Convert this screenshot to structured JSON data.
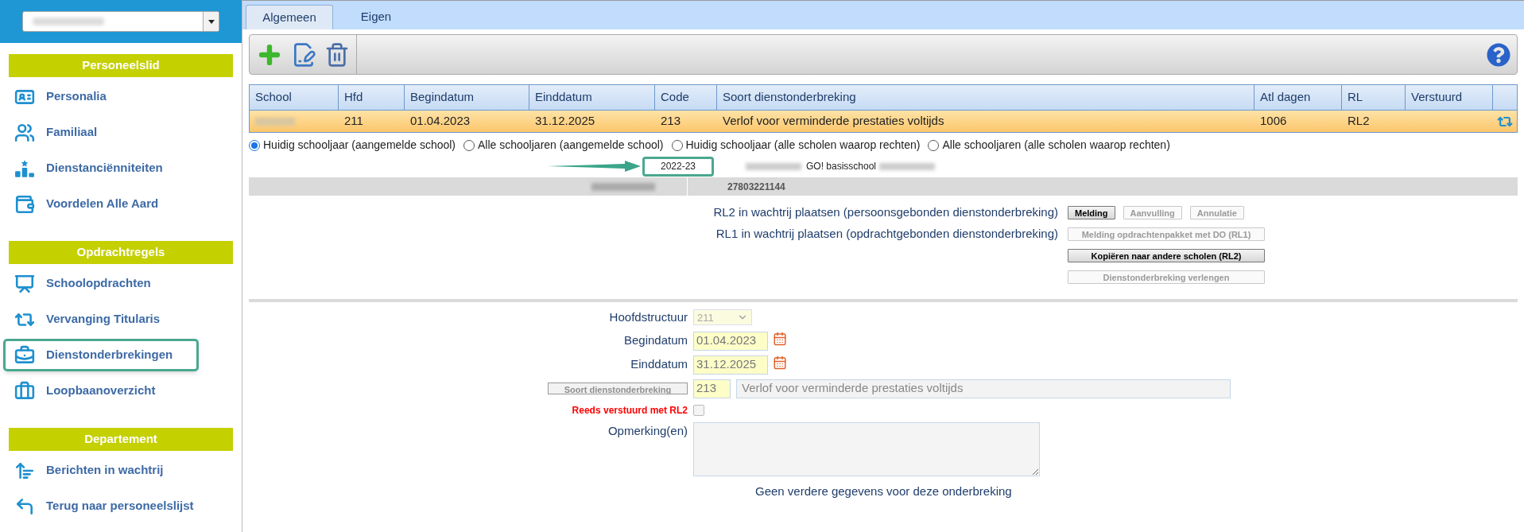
{
  "sidebar": {
    "sections": [
      {
        "title": "Personeelslid",
        "items": [
          {
            "label": "Personalia",
            "selected": false
          },
          {
            "label": "Familiaal",
            "selected": false
          },
          {
            "label": "Dienstanciënniteiten",
            "selected": false
          },
          {
            "label": "Voordelen Alle Aard",
            "selected": false
          }
        ]
      },
      {
        "title": "Opdrachtregels",
        "items": [
          {
            "label": "Schoolopdrachten",
            "selected": false
          },
          {
            "label": "Vervanging Titularis",
            "selected": false
          },
          {
            "label": "Dienstonderbrekingen",
            "selected": true
          },
          {
            "label": "Loopbaanoverzicht",
            "selected": false
          }
        ]
      },
      {
        "title": "Departement",
        "items": [
          {
            "label": "Berichten in wachtrij",
            "selected": false
          },
          {
            "label": "Terug naar personeelslijst",
            "selected": false
          }
        ]
      }
    ]
  },
  "tabs": [
    {
      "label": "Algemeen",
      "selected": true
    },
    {
      "label": "Eigen",
      "selected": false
    }
  ],
  "table": {
    "columns": [
      "School",
      "Hfd",
      "Begindatum",
      "Einddatum",
      "Code",
      "Soort dienstonderbreking",
      "Atl dagen",
      "RL",
      "Verstuurd"
    ],
    "rows": [
      {
        "selected": true,
        "hfd": "211",
        "begindatum": "01.04.2023",
        "einddatum": "31.12.2025",
        "code": "213",
        "soort": "Verlof voor verminderde prestaties voltijds",
        "atl_dagen": "1006",
        "rl": "RL2"
      }
    ]
  },
  "scope_options": [
    {
      "label": "Huidig schooljaar (aangemelde school)",
      "selected": true
    },
    {
      "label": "Alle schooljaren (aangemelde school)",
      "selected": false
    },
    {
      "label": "Huidig schooljaar (alle scholen waarop rechten)",
      "selected": false
    },
    {
      "label": "Alle schooljaren (alle scholen waarop rechten)",
      "selected": false
    }
  ],
  "school_year": "2022-23",
  "school_name": "GO! basisschool",
  "id_number": "27803221144",
  "queue_rows": [
    {
      "label": "RL2 in wachtrij plaatsen (persoonsgebonden dienstonderbreking)",
      "buttons": [
        {
          "label": "Melding",
          "disabled": false
        },
        {
          "label": "Aanvulling",
          "disabled": true
        },
        {
          "label": "Annulatie",
          "disabled": true
        }
      ]
    },
    {
      "label": "RL1 in wachtrij plaatsen (opdrachtgebonden dienstonderbreking)",
      "buttons": [
        {
          "label": "Melding opdrachtenpakket met DO (RL1)",
          "disabled": true
        }
      ]
    },
    {
      "buttons": [
        {
          "label": "Kopiëren naar andere scholen (RL2)",
          "disabled": false
        }
      ]
    },
    {
      "buttons": [
        {
          "label": "Dienstonderbreking verlengen",
          "disabled": true
        }
      ]
    }
  ],
  "form": {
    "hoofdstructuur": {
      "label": "Hoofdstructuur",
      "value": "211",
      "disabled": true
    },
    "begindatum": {
      "label": "Begindatum",
      "value": "01.04.2023"
    },
    "einddatum": {
      "label": "Einddatum",
      "value": "31.12.2025"
    },
    "soort": {
      "button": "Soort dienstonderbreking",
      "button_disabled": true,
      "code": "213",
      "description": "Verlof voor verminderde prestaties voltijds"
    },
    "verstuurd": {
      "label": "Reeds verstuurd met RL2",
      "checked": false
    },
    "opmerkingen": {
      "label": "Opmerking(en)"
    },
    "footer": "Geen verdere gegevens voor deze onderbreking"
  }
}
